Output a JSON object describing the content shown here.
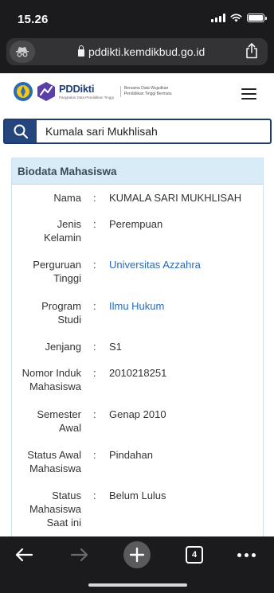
{
  "status_bar": {
    "time": "15.26"
  },
  "browser": {
    "url": "pddikti.kemdikbud.go.id",
    "open_tabs": "4"
  },
  "site": {
    "logo_name": "PDDikti",
    "logo_subtitle": "Pangkalan Data Pendidikan Tinggi",
    "tagline_line1": "Bersama Data Wujudkan",
    "tagline_line2": "Pendidikan Tinggi Bermutu"
  },
  "search": {
    "value": "Kumala sari Mukhlisah"
  },
  "biodata": {
    "heading": "Biodata Mahasiswa",
    "separator": ":",
    "rows": [
      {
        "label": "Nama",
        "value": "KUMALA SARI MUKHLISAH"
      },
      {
        "label": "Jenis Kelamin",
        "value": "Perempuan"
      },
      {
        "label": "Perguruan Tinggi",
        "value": "Universitas Azzahra"
      },
      {
        "label": "Program Studi",
        "value": "Ilmu Hukum"
      },
      {
        "label": "Jenjang",
        "value": "S1"
      },
      {
        "label": "Nomor Induk Mahasiswa",
        "value": "2010218251"
      },
      {
        "label": "Semester Awal",
        "value": "Genap 2010"
      },
      {
        "label": "Status Awal Mahasiswa",
        "value": "Pindahan"
      },
      {
        "label": "Status Mahasiswa Saat ini",
        "value": "Belum Lulus"
      }
    ]
  },
  "colors": {
    "chrome": "#1b1b1d",
    "brand_navy": "#24457e",
    "link": "#2a6bb3",
    "card_header": "#d9ebf7"
  }
}
